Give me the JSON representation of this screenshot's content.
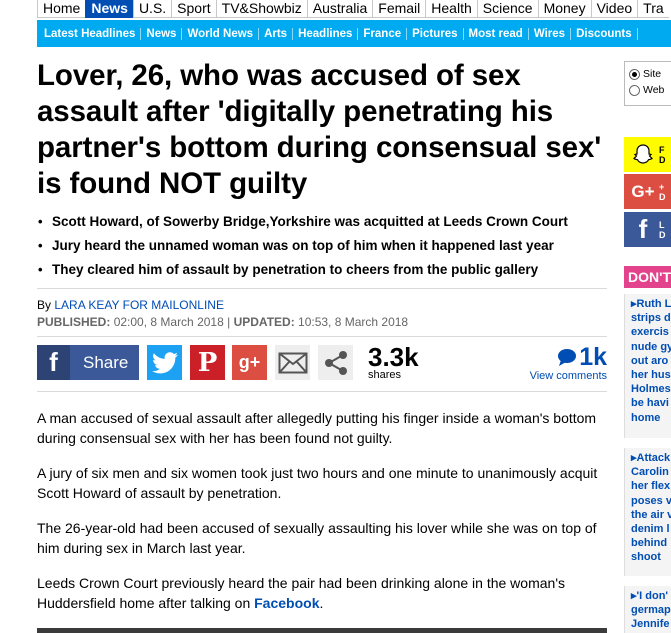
{
  "top_nav": [
    "Home",
    "News",
    "U.S.",
    "Sport",
    "TV&Showbiz",
    "Australia",
    "Femail",
    "Health",
    "Science",
    "Money",
    "Video",
    "Tra"
  ],
  "top_nav_active": "News",
  "sub_nav": [
    "Latest Headlines",
    "News",
    "World News",
    "Arts",
    "Headlines",
    "France",
    "Pictures",
    "Most read",
    "Wires",
    "Discounts"
  ],
  "article": {
    "headline": "Lover, 26, who was accused of sex assault after 'digitally penetrating his partner's bottom during consensual sex' is found NOT guilty",
    "bullets": [
      "Scott Howard, of Sowerby Bridge,Yorkshire was acquitted at Leeds Crown Court",
      "Jury heard the unnamed woman was on top of him when it happened last year",
      "They cleared him of assault by penetration to cheers from the public gallery"
    ],
    "byline_prefix": "By",
    "author": "LARA KEAY FOR MAILONLINE",
    "published_label": "PUBLISHED:",
    "published": "02:00, 8 March 2018",
    "separator": "|",
    "updated_label": "UPDATED:",
    "updated": "10:53, 8 March 2018",
    "paragraphs": [
      "A man accused of sexual assault after allegedly putting his finger inside a woman's bottom during consensual sex with her has been found not guilty.",
      "A jury of six men and six women took just two hours and one minute to unanimously acquit Scott Howard of assault by penetration.",
      "The 26-year-old had been accused of sexually assaulting his lover while she was on top of him during sex in March last year."
    ],
    "last_paragraph_text": "Leeds Crown Court previously heard the pair had been drinking alone in the woman's Huddersfield home after talking on",
    "last_paragraph_link": "Facebook",
    "last_paragraph_end": "."
  },
  "share": {
    "facebook_label": "Share",
    "shares_count": "3.3k",
    "shares_label": "shares",
    "comments_count": "1k",
    "comments_label": "View comments"
  },
  "sidebar": {
    "search_options": [
      "Site",
      "Web"
    ],
    "search_selected": "Site",
    "social": [
      {
        "lines": [
          "F",
          "D"
        ]
      },
      {
        "lines": [
          "+",
          "D"
        ]
      },
      {
        "lines": [
          "L",
          "D"
        ]
      }
    ],
    "dont_miss_label": "DON'T",
    "dont_miss_items": [
      [
        "Ruth L",
        "strips d",
        "exercis",
        "nude gy",
        "out aro",
        "her hus",
        "Holmes",
        "be havi",
        "home"
      ],
      [
        "Attack",
        "Carolin",
        "her flex",
        "poses v",
        "the air v",
        "denim l",
        "behind",
        "shoot"
      ],
      [
        "'I don'",
        "germap",
        "Jennife"
      ]
    ]
  },
  "colors": {
    "nav_active": "#004db3",
    "subnav_bg": "#00aaf0",
    "link": "#004db3",
    "facebook": "#3b5998",
    "twitter": "#1da1f2",
    "pinterest": "#cb2027",
    "googleplus": "#dc4e41",
    "snapchat": "#fffc00",
    "dont_miss": "#e3428d"
  }
}
